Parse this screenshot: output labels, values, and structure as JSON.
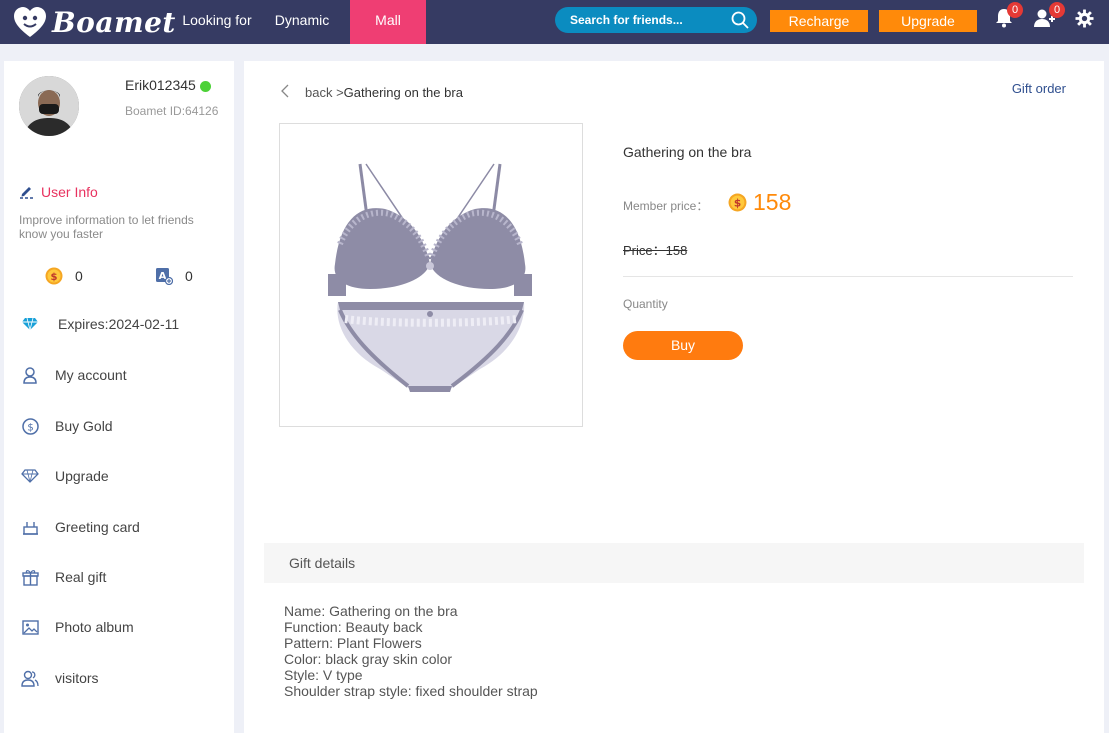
{
  "brand": {
    "name": "Boamet",
    "accent": "#ef3e73",
    "nav_bg": "#363b63",
    "orange": "#ff8a0a"
  },
  "nav": {
    "items": [
      {
        "label": "Looking for"
      },
      {
        "label": "Dynamic"
      },
      {
        "label": "Mall",
        "active": true
      }
    ],
    "search_placeholder": "Search for friends...",
    "recharge_label": "Recharge",
    "upgrade_label": "Upgrade",
    "notifications_count": "0",
    "friend_requests_count": "0"
  },
  "sidebar": {
    "username": "Erik012345",
    "boamet_id": "Boamet ID:64126",
    "user_info_label": "User Info",
    "user_info_desc": "Improve information to let friends know you faster",
    "gold_count": "0",
    "card_count": "0",
    "expires": "Expires:2024-02-11",
    "menu": [
      {
        "label": "My account",
        "icon": "person-icon"
      },
      {
        "label": "Buy Gold",
        "icon": "dollar-coin-icon"
      },
      {
        "label": "Upgrade",
        "icon": "diamond-icon"
      },
      {
        "label": "Greeting card",
        "icon": "cake-icon"
      },
      {
        "label": "Real gift",
        "icon": "gift-icon"
      },
      {
        "label": "Photo album",
        "icon": "image-icon"
      },
      {
        "label": "visitors",
        "icon": "visitors-icon"
      }
    ]
  },
  "main": {
    "breadcrumb_back": "back >",
    "breadcrumb_current": "Gathering on the bra",
    "gift_order_label": "Gift order",
    "product": {
      "name": "Gathering on the bra",
      "member_price_label": "Member price：",
      "member_price": "158",
      "original_price": "Price：158",
      "quantity_label": "Quantity",
      "buy_label": "Buy"
    },
    "details": {
      "header": "Gift details",
      "lines": [
        "Name: Gathering on the bra",
        "Function: Beauty back",
        "Pattern: Plant Flowers",
        "Color: black gray skin color",
        "Style: V type",
        "Shoulder strap style: fixed shoulder strap"
      ]
    }
  }
}
